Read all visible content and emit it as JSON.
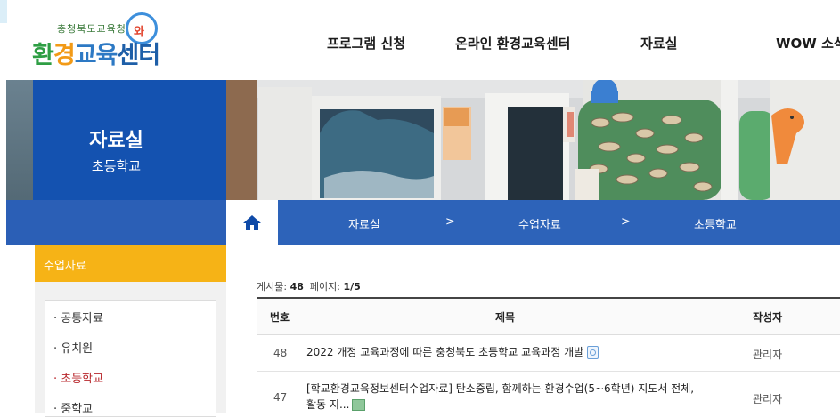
{
  "header": {
    "logo_top": "충청북도교육청",
    "logo_main": [
      "환",
      "경",
      "교육",
      "센터"
    ],
    "logo_face": "와",
    "logo_deco": "우",
    "nav": [
      "프로그램 신청",
      "온라인 환경교육센터",
      "자료실",
      "WOW 소식"
    ]
  },
  "side_title": {
    "title": "자료실",
    "subtitle": "초등학교"
  },
  "breadcrumb": [
    "자료실",
    ">",
    "수업자료",
    ">",
    "초등학교"
  ],
  "side_menu": {
    "heading": "수업자료",
    "items": [
      {
        "label": "· 공통자료",
        "active": false
      },
      {
        "label": "· 유치원",
        "active": false
      },
      {
        "label": "· 초등학교",
        "active": true
      },
      {
        "label": "· 중학교",
        "active": false
      }
    ]
  },
  "board": {
    "meta_posts_label": "게시물:",
    "meta_posts_value": "48",
    "meta_page_label": "페이지:",
    "meta_page_value": "1/5",
    "columns": [
      "번호",
      "제목",
      "작성자"
    ],
    "rows": [
      {
        "num": "48",
        "title": "2022 개정 교육과정에 따른 충청북도 초등학교 교육과정 개발",
        "title_cont": "",
        "writer": "관리자"
      },
      {
        "num": "47",
        "title": "[학교환경교육정보센터수업자료] 탄소중립, 함께하는 환경수업(5~6학년) 지도서 전체,활동",
        "title_cont": "지...",
        "writer": "관리자"
      }
    ]
  },
  "colors": {
    "primary_blue": "#1452b0",
    "accent_yellow": "#f6b316",
    "active_red": "#b8272c"
  }
}
